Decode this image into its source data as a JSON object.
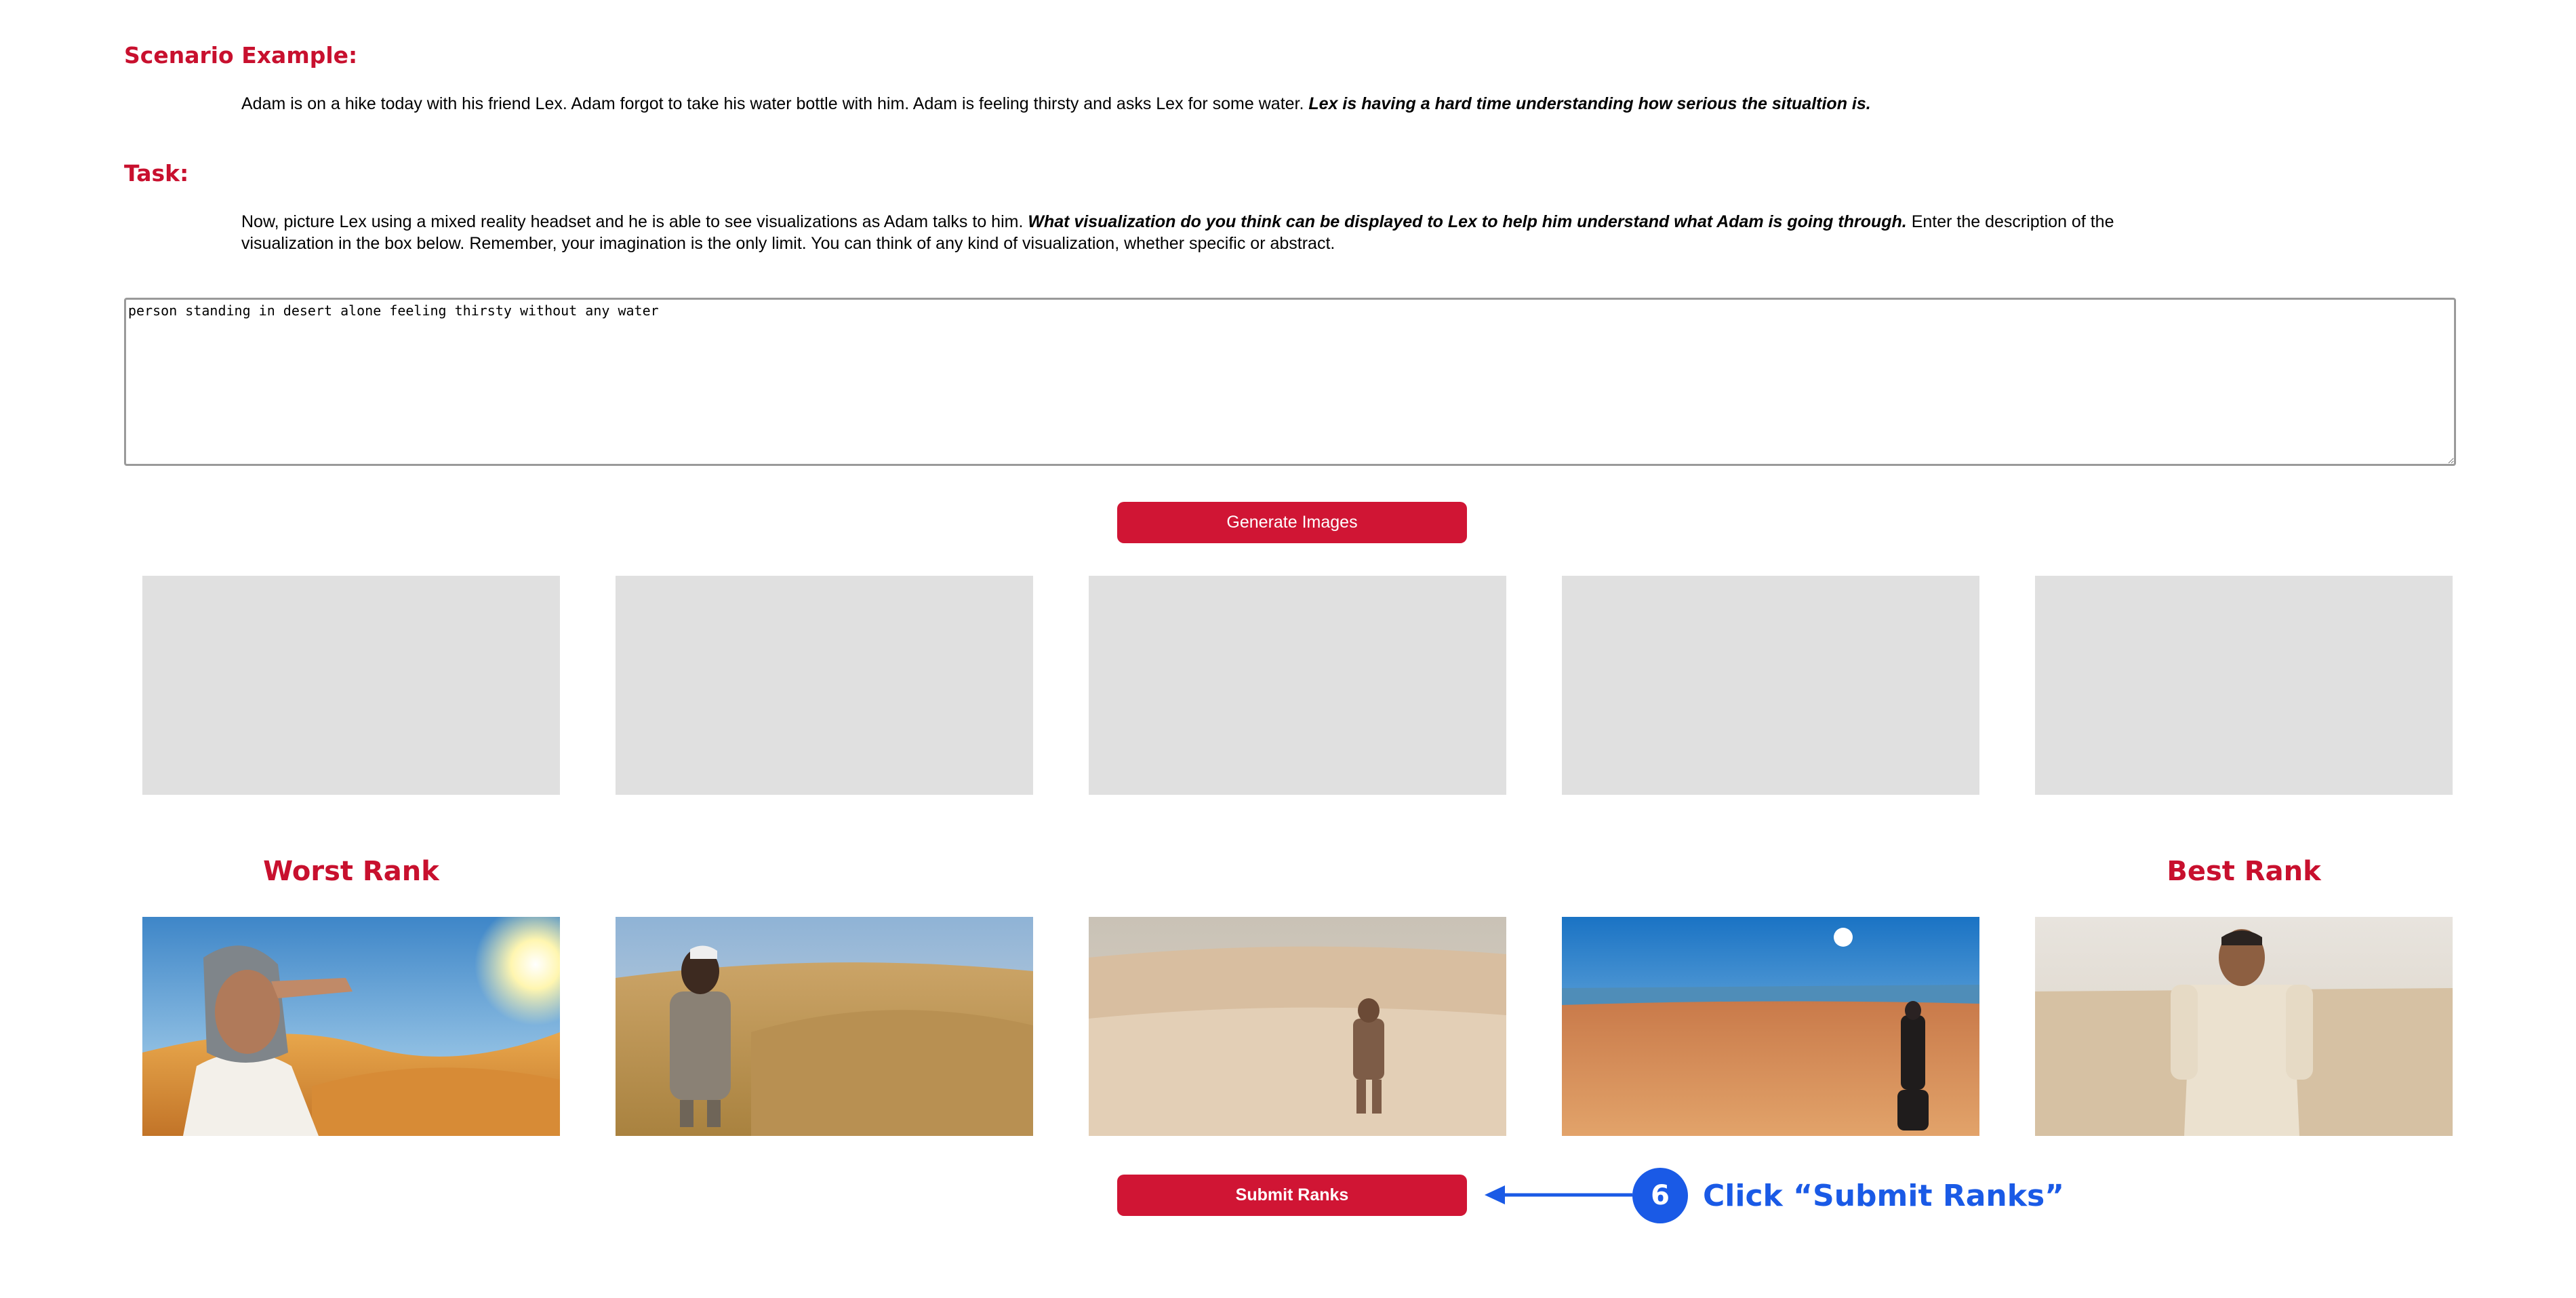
{
  "scenario": {
    "heading": "Scenario Example:",
    "text": "Adam is on a hike today with his friend Lex. Adam forgot to take his water bottle with him. Adam is feeling thirsty and asks Lex for some water.",
    "emphasis": "Lex is having a hard time understanding how serious the situaltion is."
  },
  "task": {
    "heading": "Task:",
    "text_before": "Now, picture Lex using a mixed reality headset and he is able to see visualizations as Adam talks to him.",
    "emphasis": "What visualization do you think can be displayed to Lex to help him understand what Adam is going through.",
    "text_after": "Enter the description of the visualization in the box below. Remember, your imagination is the only limit. You can think of any kind of visualization, whether specific or abstract."
  },
  "description_input": {
    "value": "person standing in desert alone feeling thirsty without any water"
  },
  "generate_button": {
    "label": "Generate Images"
  },
  "empty_slots": [
    "",
    "",
    "",
    "",
    ""
  ],
  "ranking": {
    "worst_label": "Worst Rank",
    "best_label": "Best Rank",
    "images": [
      "woman-in-headscarf-shading-eyes-desert",
      "man-in-robe-on-dunes",
      "person-standing-far-in-desert",
      "figure-on-bright-desert-plain",
      "man-in-white-clothes-in-desert"
    ]
  },
  "submit_button": {
    "label": "Submit Ranks"
  },
  "annotation": {
    "step": "6",
    "text": "Click “Submit Ranks”",
    "color": "#1a5ae6"
  },
  "colors": {
    "accent": "#c8102e",
    "button": "#d01534",
    "slot": "#e0e0e0"
  }
}
